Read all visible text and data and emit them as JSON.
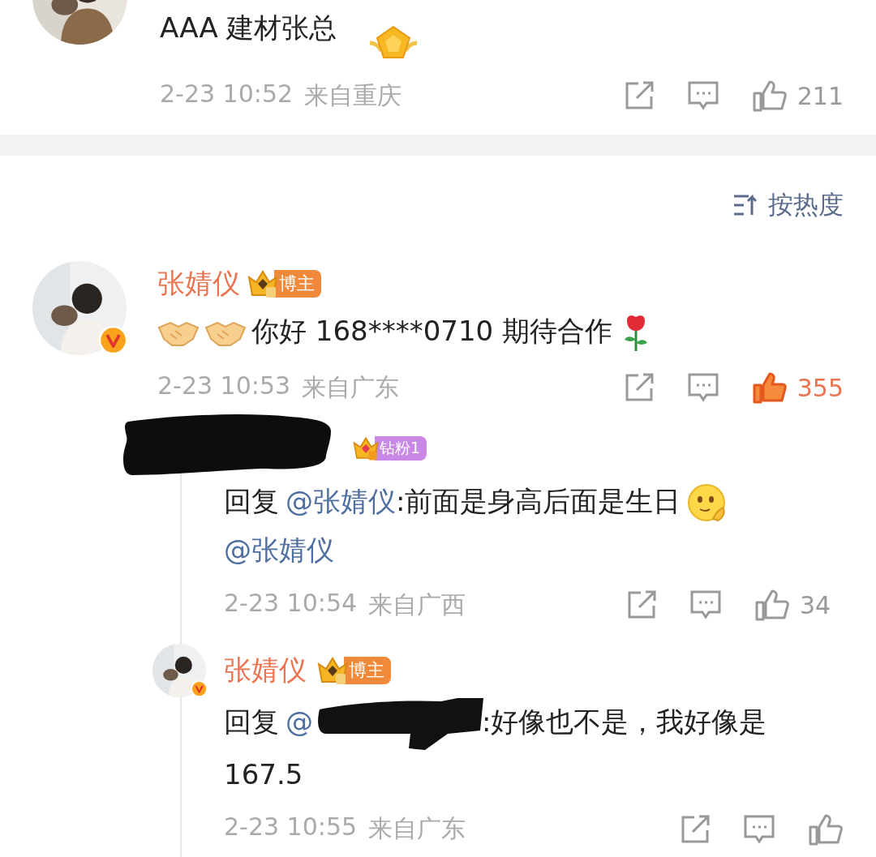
{
  "top_comment": {
    "author": "AAA 建材张总",
    "time": "2-23 10:52",
    "location": "来自重庆",
    "likes": "211",
    "liked": false
  },
  "sort": {
    "label": "按热度"
  },
  "main_comment": {
    "author": "张婧仪",
    "verified": true,
    "badge": {
      "kind": "blogger",
      "label": "博主"
    },
    "content": [
      {
        "kind": "handshake"
      },
      {
        "kind": "handshake"
      },
      {
        "kind": "text",
        "text": "你好 168****0710 期待合作"
      },
      {
        "kind": "rose"
      }
    ],
    "time": "2-23 10:53",
    "location": "来自广东",
    "likes": "355",
    "liked": true,
    "replies": [
      {
        "redacted": true,
        "badge": {
          "kind": "fan",
          "label": "钻粉1"
        },
        "content": [
          {
            "kind": "text",
            "text": "回复"
          },
          {
            "kind": "mention",
            "text": "@张婧仪"
          },
          {
            "kind": "text",
            "text": ":前面是身高后面是生日"
          },
          {
            "kind": "face"
          },
          {
            "kind": "break"
          },
          {
            "kind": "mention",
            "text": "@张婧仪"
          }
        ],
        "time": "2-23 10:54",
        "location": "来自广西",
        "likes": "34",
        "liked": false
      },
      {
        "redacted": false,
        "verified": true,
        "author": "张婧仪",
        "badge": {
          "kind": "blogger",
          "label": "博主"
        },
        "content": [
          {
            "kind": "text",
            "text": "回复"
          },
          {
            "kind": "mention",
            "text": "@"
          },
          {
            "kind": "redaction"
          },
          {
            "kind": "text",
            "text": ":好像也不是，我好像是"
          },
          {
            "kind": "break"
          },
          {
            "kind": "text",
            "text": "167.5"
          }
        ],
        "time": "2-23 10:55",
        "location": "来自广东",
        "liked": false
      }
    ]
  }
}
